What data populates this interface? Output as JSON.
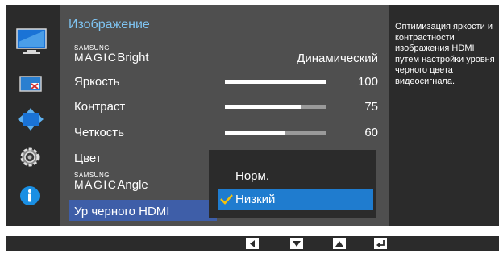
{
  "menu": {
    "title": "Изображение",
    "items": [
      {
        "brand": "SAMSUNG",
        "magic": "MAGIC",
        "label": "Bright",
        "value": "Динамический"
      },
      {
        "label": "Яркость",
        "value": "100",
        "level": 1.0
      },
      {
        "label": "Контраст",
        "value": "75",
        "level": 0.75
      },
      {
        "label": "Четкость",
        "value": "60",
        "level": 0.6
      },
      {
        "label": "Цвет"
      },
      {
        "brand": "SAMSUNG",
        "magic": "MAGIC",
        "label": "Angle"
      },
      {
        "label": "Ур черного HDMI"
      }
    ]
  },
  "dropdown": {
    "options": [
      {
        "label": "Норм."
      },
      {
        "label": "Низкий"
      }
    ],
    "selected_index": 1
  },
  "description": "Оптимизация яркости и контрастности изображения HDMI путем настройки уровня черного цвета видеосигнала.",
  "sidebar": {
    "icons": [
      "picture-icon",
      "color-screen-icon",
      "position-arrows-icon",
      "settings-gear-icon",
      "info-icon"
    ]
  },
  "bottom_keys": [
    "left-arrow-key-icon",
    "down-arrow-key-icon",
    "up-arrow-key-icon",
    "enter-key-icon"
  ],
  "colors": {
    "accent_blue": "#7fc4f2",
    "selection": "#3e5ea8",
    "dropdown_selection": "#1f7ccf",
    "check_yellow": "#f4c20d",
    "info_blue": "#1a8fe3"
  }
}
